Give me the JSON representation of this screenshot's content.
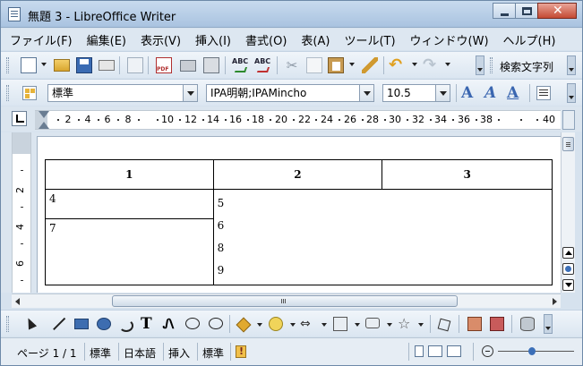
{
  "window": {
    "title": "無題 3 - LibreOffice Writer",
    "close_glyph": "✕"
  },
  "menu": [
    "ファイル(F)",
    "編集(E)",
    "表示(V)",
    "挿入(I)",
    "書式(O)",
    "表(A)",
    "ツール(T)",
    "ウィンドウ(W)",
    "ヘルプ(H)"
  ],
  "standard_toolbar": {
    "spell_icon_text": "ABC",
    "cut_glyph": "✂",
    "undo_glyph": "↶",
    "redo_glyph": "↷",
    "find_label": "検索文字列"
  },
  "format_toolbar": {
    "paragraph_style": "標準",
    "font_name": "IPA明朝;IPAMincho",
    "font_size": "10.5",
    "bold_label": "A",
    "italic_label": "A",
    "underline_label": "A"
  },
  "ruler": {
    "numbers": [
      "2",
      "4",
      "6",
      "8",
      "10",
      "12",
      "14",
      "16",
      "18",
      "20",
      "22",
      "24",
      "26",
      "28",
      "30",
      "32",
      "34",
      "36",
      "38",
      "40"
    ],
    "vertical_numbers": [
      "2",
      "4",
      "6"
    ]
  },
  "table": {
    "header": [
      "1",
      "2",
      "3"
    ],
    "cell_4": "4",
    "cell_7": "7",
    "col2_lines": [
      "5",
      "6",
      "8",
      "9"
    ]
  },
  "drawing_toolbar": {
    "text_label": "T",
    "fontwork_label": "Ꮑ",
    "arrows_glyph": "⇔",
    "star_glyph": "☆"
  },
  "statusbar": {
    "page": "ページ 1 / 1",
    "page_style": "標準",
    "language": "日本語",
    "insert_mode": "挿入",
    "selection_mode": "標準"
  },
  "zoom": {
    "level_fraction": 0.45
  },
  "colors": {
    "accent": "#3a66b0",
    "title_bar": "#b5cce6"
  }
}
